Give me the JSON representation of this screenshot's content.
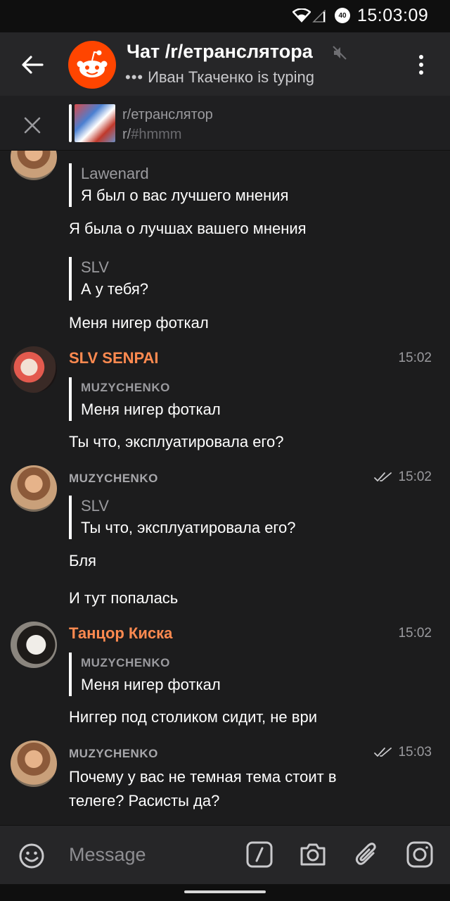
{
  "status_bar": {
    "time": "15:03:09",
    "battery": "40"
  },
  "header": {
    "title": "Чат /r/етранслятора",
    "typing_dots": "•••",
    "typing": "Иван Ткаченко is typing"
  },
  "pinned": {
    "line1": "r/етранслятор",
    "line2_prefix": "r/",
    "line2_hash": "#hmmm"
  },
  "messages": {
    "m1": {
      "quote_name": "Lawenard",
      "quote_text": "Я был о вас лучшего мнения",
      "text": "Я была о лучшах вашего мнения"
    },
    "m2": {
      "quote_name": "SLV",
      "quote_text": "А у тебя?",
      "text": "Меня нигер фоткал"
    },
    "m3": {
      "sender": "SLV SENPAI",
      "time": "15:02",
      "quote_name": "MUZYCHENKO",
      "quote_text": "Меня нигер фоткал",
      "text": "Ты что, эксплуатировала его?"
    },
    "m4": {
      "sender": "MUZYCHENKO",
      "time": "15:02",
      "quote_name": "SLV",
      "quote_text": "Ты что, эксплуатировала его?",
      "text1": "Бля",
      "text2": "И тут попалась"
    },
    "m5": {
      "sender": "Танцор Киска",
      "time": "15:02",
      "quote_name": "MUZYCHENKO",
      "quote_text": "Меня нигер фоткал",
      "text": "Ниггер под столиком сидит, не ври"
    },
    "m6": {
      "sender": "MUZYCHENKO",
      "time": "15:03",
      "text": "Почему у вас не темная тема стоит в телеге? Расисты да?"
    }
  },
  "composer": {
    "placeholder": "Message"
  },
  "colors": {
    "accent": "#ff8a50",
    "reddit": "#ff4500",
    "background": "#1c1c1d",
    "header": "#262628"
  }
}
